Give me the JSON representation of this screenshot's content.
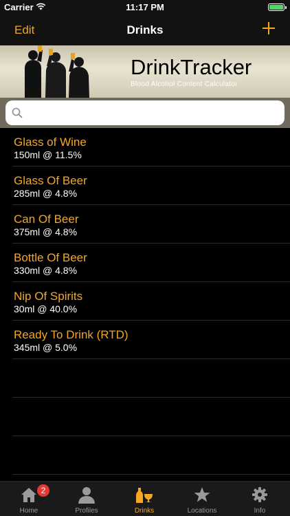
{
  "status_bar": {
    "carrier": "Carrier",
    "time": "11:17 PM"
  },
  "nav": {
    "edit_label": "Edit",
    "title": "Drinks",
    "add_icon": "plus-icon"
  },
  "banner": {
    "app_name": "DrinkTracker",
    "subtitle": "Blood Alcohol Content Calculator"
  },
  "search": {
    "placeholder": "",
    "value": ""
  },
  "drinks": [
    {
      "name": "Glass of Wine",
      "detail": "150ml @ 11.5%"
    },
    {
      "name": "Glass Of Beer",
      "detail": "285ml @ 4.8%"
    },
    {
      "name": "Can Of Beer",
      "detail": "375ml @ 4.8%"
    },
    {
      "name": "Bottle Of Beer",
      "detail": "330ml @ 4.8%"
    },
    {
      "name": "Nip Of Spirits",
      "detail": "30ml @ 40.0%"
    },
    {
      "name": "Ready To Drink (RTD)",
      "detail": "345ml @ 5.0%"
    }
  ],
  "tabs": [
    {
      "label": "Home",
      "icon": "home-icon",
      "badge": "2"
    },
    {
      "label": "Profiles",
      "icon": "person-icon"
    },
    {
      "label": "Drinks",
      "icon": "drinks-icon",
      "active": true
    },
    {
      "label": "Locations",
      "icon": "star-icon"
    },
    {
      "label": "Info",
      "icon": "gear-icon"
    }
  ],
  "colors": {
    "accent": "#f5a623",
    "background": "#000000",
    "bar": "#121212",
    "badge": "#e53935"
  }
}
